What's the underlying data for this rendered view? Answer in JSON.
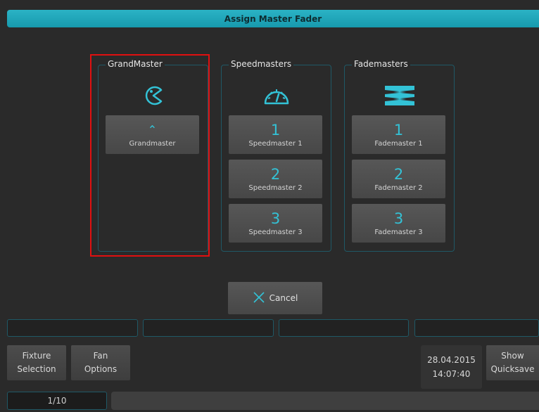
{
  "dialog": {
    "title": "Assign Master Fader"
  },
  "groups": {
    "grandmaster": {
      "title": "GrandMaster",
      "icon": "pacman-icon",
      "buttons": [
        {
          "num": "⌃",
          "label": "Grandmaster"
        }
      ]
    },
    "speedmasters": {
      "title": "Speedmasters",
      "icon": "speedometer-icon",
      "buttons": [
        {
          "num": "1",
          "label": "Speedmaster 1"
        },
        {
          "num": "2",
          "label": "Speedmaster 2"
        },
        {
          "num": "3",
          "label": "Speedmaster 3"
        }
      ]
    },
    "fademasters": {
      "title": "Fademasters",
      "icon": "fade-icon",
      "buttons": [
        {
          "num": "1",
          "label": "Fademaster 1"
        },
        {
          "num": "2",
          "label": "Fademaster 2"
        },
        {
          "num": "3",
          "label": "Fademaster 3"
        }
      ]
    }
  },
  "cancel": {
    "label": "Cancel",
    "icon": "close-icon"
  },
  "softkeys": {
    "fixture_line1": "Fixture",
    "fixture_line2": "Selection",
    "fan_line1": "Fan",
    "fan_line2": "Options",
    "show_line1": "Show",
    "show_line2": "Quicksave"
  },
  "clock": {
    "date": "28.04.2015",
    "time": "14:07:40"
  },
  "pager": {
    "page": "1/10"
  },
  "colors": {
    "accent": "#1fa9bc",
    "highlight": "#e01010",
    "button": "#4f4f4f"
  }
}
